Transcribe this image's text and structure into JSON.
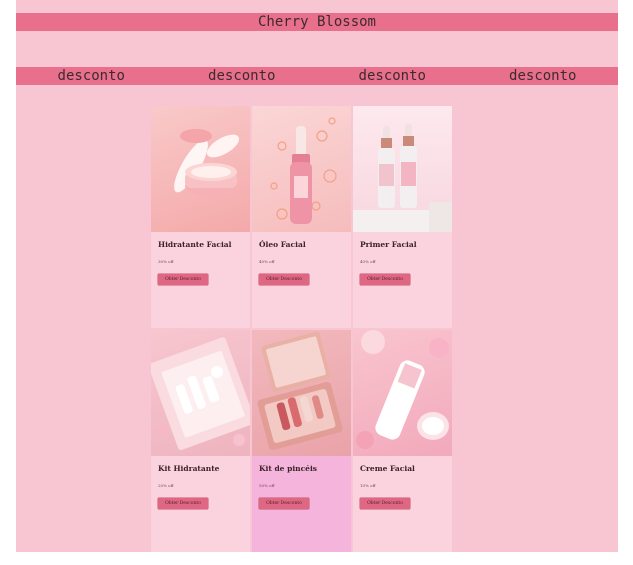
{
  "header": {
    "title": "Cherry Blossom"
  },
  "promo": {
    "items": [
      "desconto",
      "desconto",
      "desconto",
      "desconto"
    ]
  },
  "products": [
    {
      "name": "Hidratante Facial",
      "discount": "30% off",
      "button": "Obter Desconto"
    },
    {
      "name": "Óleo Facial",
      "discount": "40% off",
      "button": "Obter Desconto"
    },
    {
      "name": "Primer Facial",
      "discount": "40% off",
      "button": "Obter Desconto"
    },
    {
      "name": "Kit Hidratante",
      "discount": "20% off",
      "button": "Obter Desconto"
    },
    {
      "name": "Kit de pincéis",
      "discount": "50% off",
      "button": "Obter Desconto"
    },
    {
      "name": "Creme Facial",
      "discount": "10% off",
      "button": "Obter Desconto"
    }
  ],
  "colors": {
    "page_bg": "#f8c5d3",
    "bar": "#e8708c",
    "card_bg": "#fbd3de",
    "card_alt_bg": "#f5b4db",
    "button": "#e06783"
  }
}
